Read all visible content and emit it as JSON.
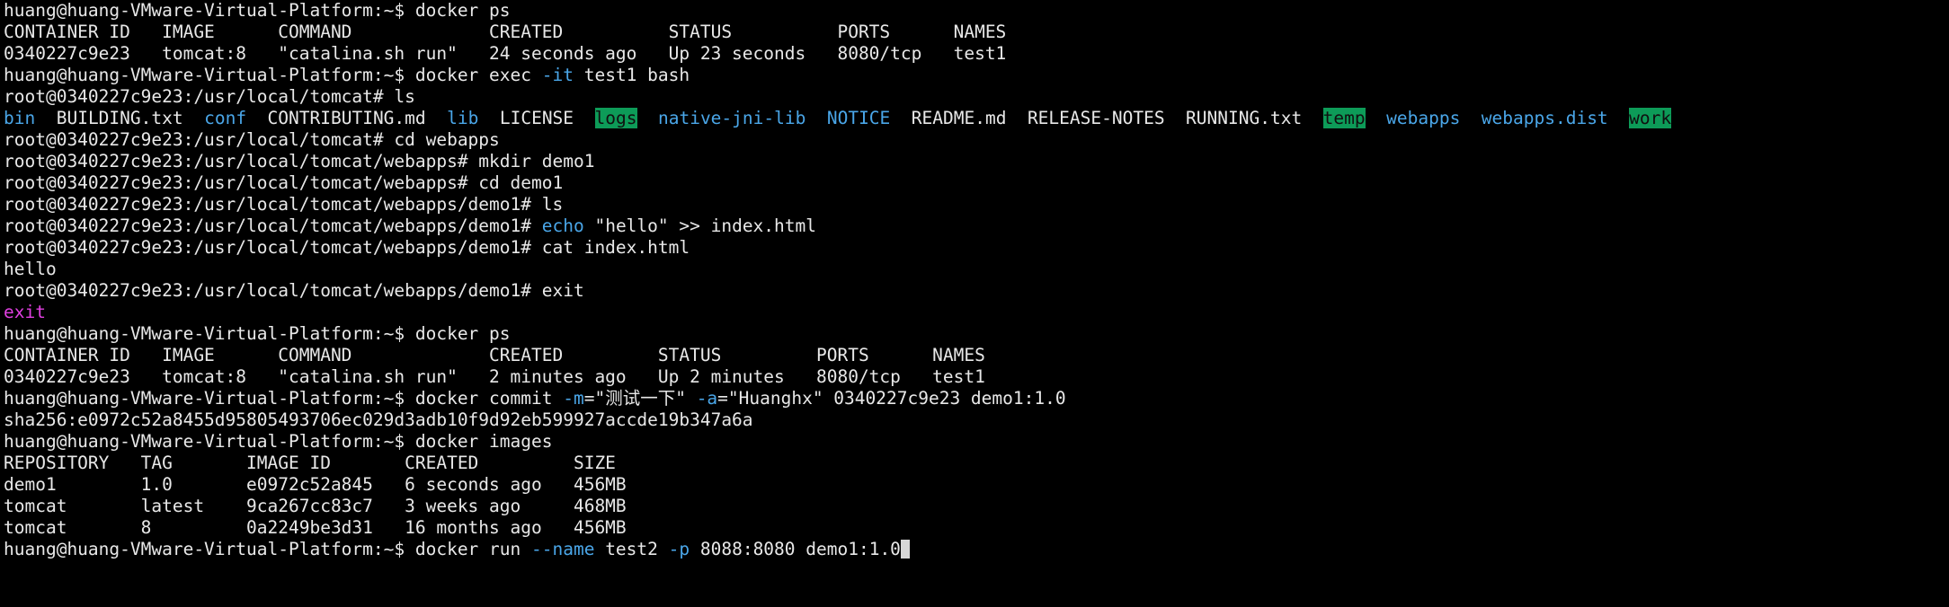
{
  "colors": {
    "background": "#000000",
    "foreground": "#e8e8e8",
    "blue": "#4aa6e8",
    "magenta": "#e040e0",
    "green_highlight": "#0d9b58",
    "cursor": "#d8d8d8"
  },
  "lines": [
    {
      "segments": [
        {
          "t": "huang@huang-VMware-Virtual-Platform:~$ docker ps",
          "c": "plain"
        }
      ]
    },
    {
      "segments": [
        {
          "t": "CONTAINER ID   IMAGE      COMMAND             CREATED          STATUS          PORTS      NAMES",
          "c": "plain"
        }
      ]
    },
    {
      "segments": [
        {
          "t": "0340227c9e23   tomcat:8   \"catalina.sh run\"   24 seconds ago   Up 23 seconds   8080/tcp   test1",
          "c": "plain"
        }
      ]
    },
    {
      "segments": [
        {
          "t": "huang@huang-VMware-Virtual-Platform:~$ docker exec ",
          "c": "plain"
        },
        {
          "t": "-it",
          "c": "blue"
        },
        {
          "t": " test1 bash",
          "c": "plain"
        }
      ]
    },
    {
      "segments": [
        {
          "t": "root@0340227c9e23:/usr/local/tomcat# ls",
          "c": "plain"
        }
      ]
    },
    {
      "segments": [
        {
          "t": "bin",
          "c": "blue"
        },
        {
          "t": "  ",
          "c": "plain"
        },
        {
          "t": "BUILDING.txt",
          "c": "plain"
        },
        {
          "t": "  ",
          "c": "plain"
        },
        {
          "t": "conf",
          "c": "blue"
        },
        {
          "t": "  ",
          "c": "plain"
        },
        {
          "t": "CONTRIBUTING.md",
          "c": "plain"
        },
        {
          "t": "  ",
          "c": "plain"
        },
        {
          "t": "lib",
          "c": "blue"
        },
        {
          "t": "  ",
          "c": "plain"
        },
        {
          "t": "LICENSE",
          "c": "plain"
        },
        {
          "t": "  ",
          "c": "plain"
        },
        {
          "t": "logs",
          "c": "greenbg"
        },
        {
          "t": "  ",
          "c": "plain"
        },
        {
          "t": "native-jni-lib",
          "c": "blue"
        },
        {
          "t": "  ",
          "c": "plain"
        },
        {
          "t": "NOTICE",
          "c": "blue"
        },
        {
          "t": "  ",
          "c": "plain"
        },
        {
          "t": "README.md",
          "c": "plain"
        },
        {
          "t": "  ",
          "c": "plain"
        },
        {
          "t": "RELEASE-NOTES",
          "c": "plain"
        },
        {
          "t": "  ",
          "c": "plain"
        },
        {
          "t": "RUNNING.txt",
          "c": "plain"
        },
        {
          "t": "  ",
          "c": "plain"
        },
        {
          "t": "temp",
          "c": "greenbg"
        },
        {
          "t": "  ",
          "c": "plain"
        },
        {
          "t": "webapps",
          "c": "blue"
        },
        {
          "t": "  ",
          "c": "plain"
        },
        {
          "t": "webapps.dist",
          "c": "blue"
        },
        {
          "t": "  ",
          "c": "plain"
        },
        {
          "t": "work",
          "c": "greenbg"
        }
      ]
    },
    {
      "segments": [
        {
          "t": "root@0340227c9e23:/usr/local/tomcat# cd webapps",
          "c": "plain"
        }
      ]
    },
    {
      "segments": [
        {
          "t": "root@0340227c9e23:/usr/local/tomcat/webapps# mkdir demo1",
          "c": "plain"
        }
      ]
    },
    {
      "segments": [
        {
          "t": "root@0340227c9e23:/usr/local/tomcat/webapps# cd demo1",
          "c": "plain"
        }
      ]
    },
    {
      "segments": [
        {
          "t": "root@0340227c9e23:/usr/local/tomcat/webapps/demo1# ls",
          "c": "plain"
        }
      ]
    },
    {
      "segments": [
        {
          "t": "root@0340227c9e23:/usr/local/tomcat/webapps/demo1# ",
          "c": "plain"
        },
        {
          "t": "echo",
          "c": "blue"
        },
        {
          "t": " \"hello\" >> index.html",
          "c": "plain"
        }
      ]
    },
    {
      "segments": [
        {
          "t": "root@0340227c9e23:/usr/local/tomcat/webapps/demo1# cat index.html",
          "c": "plain"
        }
      ]
    },
    {
      "segments": [
        {
          "t": "hello",
          "c": "plain"
        }
      ]
    },
    {
      "segments": [
        {
          "t": "root@0340227c9e23:/usr/local/tomcat/webapps/demo1# exit",
          "c": "plain"
        }
      ]
    },
    {
      "segments": [
        {
          "t": "exit",
          "c": "magenta"
        }
      ]
    },
    {
      "segments": [
        {
          "t": "huang@huang-VMware-Virtual-Platform:~$ docker ps",
          "c": "plain"
        }
      ]
    },
    {
      "segments": [
        {
          "t": "CONTAINER ID   IMAGE      COMMAND             CREATED         STATUS         PORTS      NAMES",
          "c": "plain"
        }
      ]
    },
    {
      "segments": [
        {
          "t": "0340227c9e23   tomcat:8   \"catalina.sh run\"   2 minutes ago   Up 2 minutes   8080/tcp   test1",
          "c": "plain"
        }
      ]
    },
    {
      "segments": [
        {
          "t": "huang@huang-VMware-Virtual-Platform:~$ docker commit ",
          "c": "plain"
        },
        {
          "t": "-m",
          "c": "blue"
        },
        {
          "t": "=\"测试一下\" ",
          "c": "plain"
        },
        {
          "t": "-a",
          "c": "blue"
        },
        {
          "t": "=\"Huanghx\" 0340227c9e23 demo1:1.0",
          "c": "plain"
        }
      ]
    },
    {
      "segments": [
        {
          "t": "sha256:e0972c52a8455d95805493706ec029d3adb10f9d92eb599927accde19b347a6a",
          "c": "plain"
        }
      ]
    },
    {
      "segments": [
        {
          "t": "huang@huang-VMware-Virtual-Platform:~$ docker images",
          "c": "plain"
        }
      ]
    },
    {
      "segments": [
        {
          "t": "REPOSITORY   TAG       IMAGE ID       CREATED         SIZE",
          "c": "plain"
        }
      ]
    },
    {
      "segments": [
        {
          "t": "demo1        1.0       e0972c52a845   6 seconds ago   456MB",
          "c": "plain"
        }
      ]
    },
    {
      "segments": [
        {
          "t": "tomcat       latest    9ca267cc83c7   3 weeks ago     468MB",
          "c": "plain"
        }
      ]
    },
    {
      "segments": [
        {
          "t": "tomcat       8         0a2249be3d31   16 months ago   456MB",
          "c": "plain"
        }
      ]
    },
    {
      "segments": [
        {
          "t": "huang@huang-VMware-Virtual-Platform:~$ docker run ",
          "c": "plain"
        },
        {
          "t": "--name",
          "c": "blue"
        },
        {
          "t": " test2 ",
          "c": "plain"
        },
        {
          "t": "-p",
          "c": "blue"
        },
        {
          "t": " 8088:8080 demo1:1.0",
          "c": "plain"
        }
      ],
      "cursor": true
    }
  ]
}
